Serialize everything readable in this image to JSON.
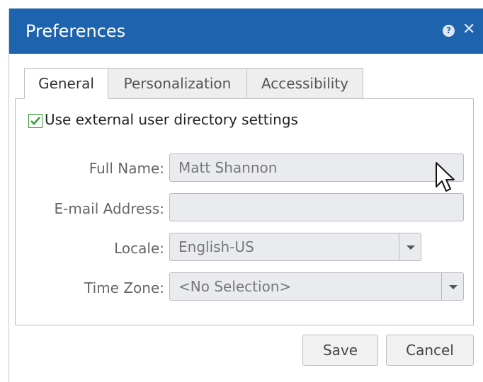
{
  "dialog": {
    "title": "Preferences",
    "help_icon_glyph": "?",
    "close_icon_glyph": "✕"
  },
  "tabs": [
    {
      "label": "General",
      "active": true
    },
    {
      "label": "Personalization",
      "active": false
    },
    {
      "label": "Accessibility",
      "active": false
    }
  ],
  "settings": {
    "external_directory_label": "Use external user directory settings",
    "external_directory_checked": true
  },
  "form": {
    "full_name_label": "Full Name:",
    "full_name_value": "Matt Shannon",
    "email_label": "E-mail Address:",
    "email_value": "",
    "locale_label": "Locale:",
    "locale_value": "English-US",
    "timezone_label": "Time Zone:",
    "timezone_value": "<No Selection>"
  },
  "buttons": {
    "save": "Save",
    "cancel": "Cancel"
  },
  "colors": {
    "titlebar": "#1e63ad",
    "checkbox_check": "#2f9c2f"
  }
}
